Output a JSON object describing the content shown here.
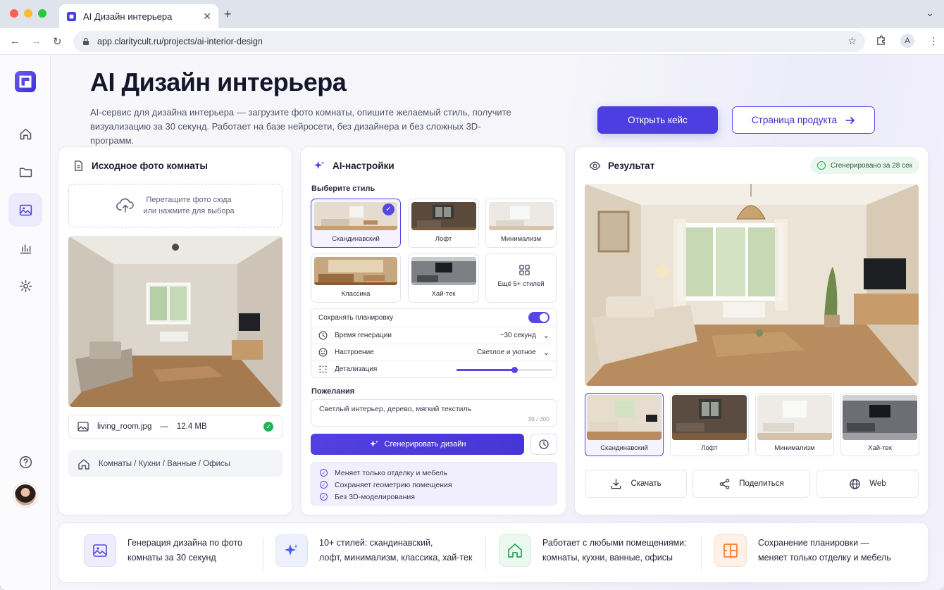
{
  "browser": {
    "tab_title": "AI Дизайн интерьера",
    "url": "app.claritycult.ru/projects/ai-interior-design",
    "profile_initial": "A"
  },
  "sidebar": {
    "items": [
      {
        "name": "home"
      },
      {
        "name": "projects"
      },
      {
        "name": "gallery",
        "active": true
      },
      {
        "name": "analytics"
      },
      {
        "name": "settings"
      }
    ]
  },
  "hero": {
    "title": "AI Дизайн интерьера",
    "subtitle": "AI-сервис для дизайна интерьера — загрузите фото комнаты, опишите желаемый стиль, получите визуализацию за 30 секунд. Работает на базе нейросети, без дизайнера и без сложных 3D-программ.",
    "primary_button": "Открыть кейс",
    "secondary_button": "Страница продукта"
  },
  "source_card": {
    "title": "Исходное фото комнаты",
    "drop_line1": "Перетащите фото сюда",
    "drop_line2": "или нажмите для выбора",
    "file_name": "living_room.jpg",
    "file_sep": "—",
    "file_size": "12.4 MB",
    "room_types": "Комнаты / Кухни / Ванные / Офисы"
  },
  "ai_card": {
    "title": "AI-настройки",
    "style_label": "Выберите стиль",
    "styles": [
      {
        "label": "Скандинавский",
        "selected": true
      },
      {
        "label": "Лофт"
      },
      {
        "label": "Минимализм"
      },
      {
        "label": "Классика"
      },
      {
        "label": "Хай-тек"
      }
    ],
    "more_styles": "Ещё 5+ стилей",
    "keep_layout_label": "Сохранять планировку",
    "keep_layout_on": true,
    "gen_time_label": "Время генерации",
    "gen_time_value": "~30 секунд",
    "mood_label": "Настроение",
    "mood_value": "Светлое и уютное",
    "detail_label": "Детализация",
    "detail_level": 0.6,
    "wishes_label": "Пожелания",
    "wishes_value": "Светлый интерьер, дерево, мягкий текстиль",
    "wishes_count": "39 / 300",
    "generate_button": "Сгенерировать дизайн",
    "benefits": [
      "Меняет только отделку и мебель",
      "Сохраняет геометрию помещения",
      "Без 3D-моделирования"
    ]
  },
  "result_card": {
    "title": "Результат",
    "badge": "Сгенерировано за 28 сек",
    "variants": [
      {
        "label": "Скандинавский",
        "selected": true
      },
      {
        "label": "Лофт"
      },
      {
        "label": "Минимализм"
      },
      {
        "label": "Хай-тек"
      }
    ],
    "actions": {
      "download": "Скачать",
      "share": "Поделиться",
      "web": "Web"
    }
  },
  "features": [
    {
      "line1": "Генерация дизайна по фото",
      "line2": "комнаты за 30 секунд",
      "color": "#5646e4"
    },
    {
      "line1": "10+ стилей: скандинавский,",
      "line2": "лофт, минимализм, классика, хай-тек",
      "color": "#4a5de6"
    },
    {
      "line1": "Работает с любыми помещениями:",
      "line2": "комнаты, кухни, ванные, офисы",
      "color": "#28a457"
    },
    {
      "line1": "Сохранение планировки —",
      "line2": "меняет только отделку и мебель",
      "color": "#f07a2a"
    }
  ],
  "colors": {
    "accent": "#4c3ee0",
    "success": "#22b35a"
  }
}
